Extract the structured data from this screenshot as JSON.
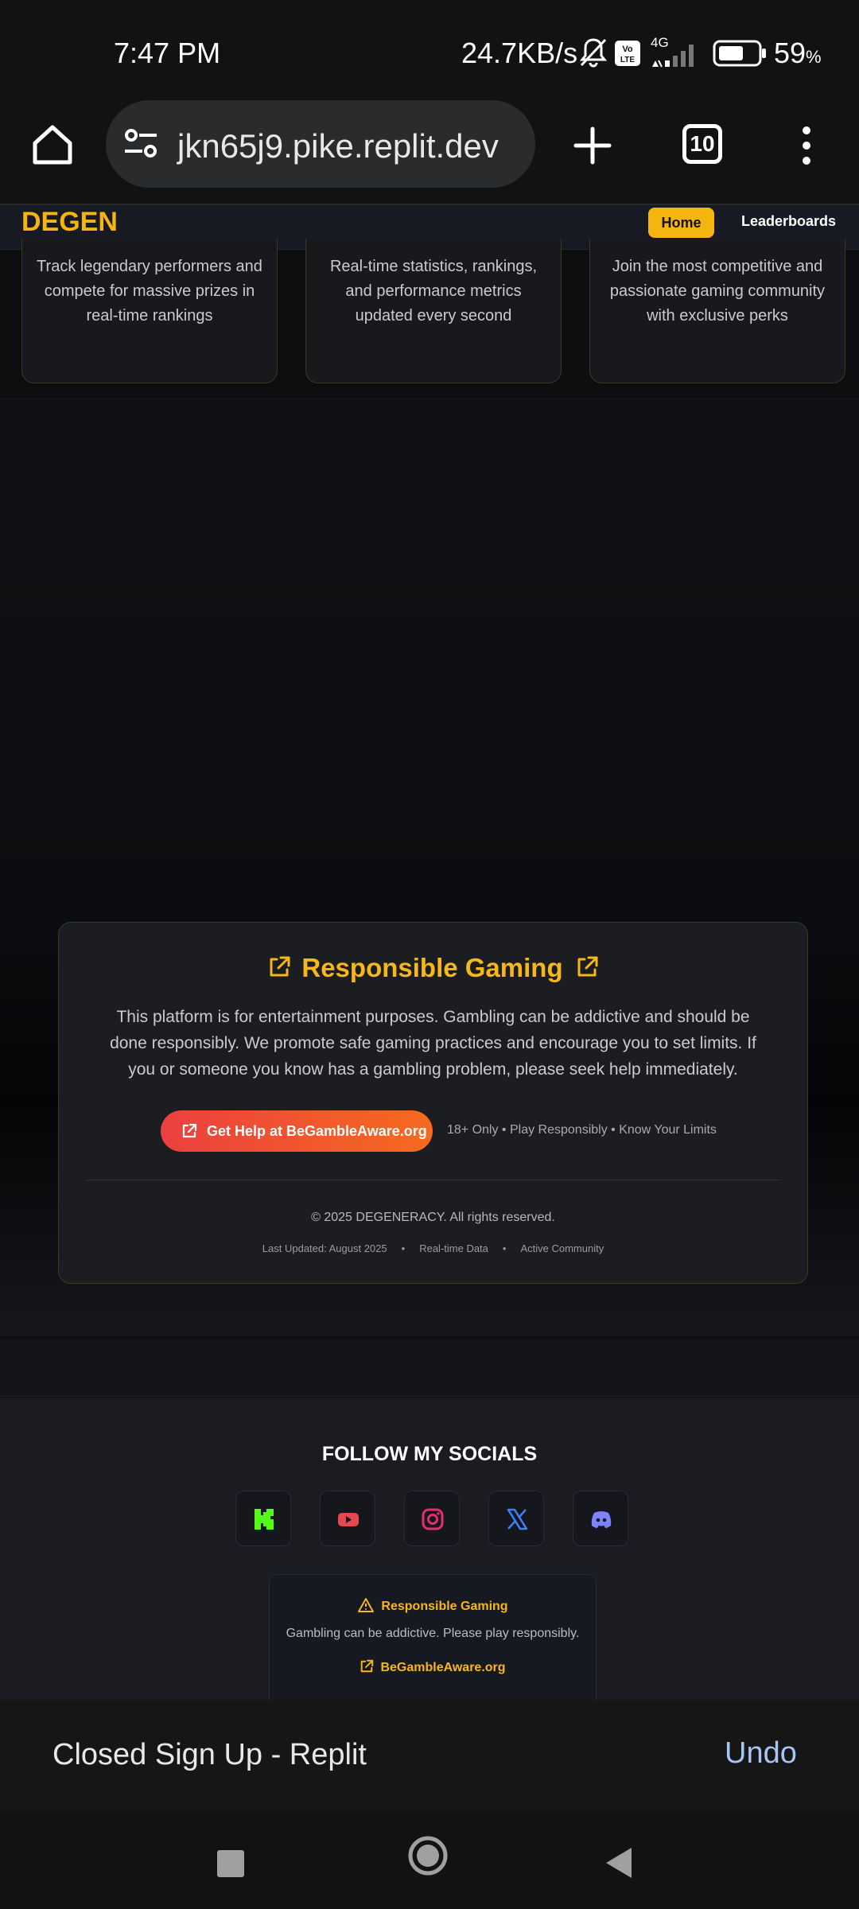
{
  "status_bar": {
    "time": "7:47 PM",
    "network_speed": "24.7KB/s",
    "network_type": "4G",
    "battery": "59",
    "battery_unit": "%"
  },
  "browser": {
    "url": "jkn65j9.pike.replit.dev",
    "tabs_count": "10"
  },
  "site_nav": {
    "brand": "DEGEN",
    "items": [
      {
        "label": "Home"
      },
      {
        "label": "Leaderboards"
      }
    ]
  },
  "features": [
    {
      "text": "Track legendary performers and compete for massive prizes in real-time rankings"
    },
    {
      "text": "Real-time statistics, rankings, and performance metrics updated every second"
    },
    {
      "text": "Join the most competitive and passionate gaming community with exclusive perks"
    }
  ],
  "responsible_gaming": {
    "title": "Responsible Gaming",
    "text": "This platform is for entertainment purposes. Gambling can be addictive and should be done responsibly. We promote safe gaming practices and encourage you to set limits. If you or someone you know has a gambling problem, please seek help immediately.",
    "help_button": "Get Help at BeGambleAware.org",
    "aux": "18+ Only • Play Responsibly • Know Your Limits",
    "copyright": "© 2025 DEGENERACY. All rights reserved.",
    "meta": [
      "Last Updated: August 2025",
      "Real-time Data",
      "Active Community"
    ],
    "meta_separator": "•"
  },
  "footer": {
    "follow_title": "FOLLOW MY SOCIALS",
    "socials": [
      {
        "icon": "kick-icon",
        "color": "#53fc18"
      },
      {
        "icon": "youtube-icon",
        "color": "#e5484d"
      },
      {
        "icon": "instagram-icon",
        "color": "#e1306c"
      },
      {
        "icon": "x-icon",
        "color": "#3b82f6"
      },
      {
        "icon": "discord-icon",
        "color": "#7c83fd"
      }
    ],
    "mini_rg": {
      "title": "Responsible Gaming",
      "text": "Gambling can be addictive. Please play responsibly.",
      "link": "BeGambleAware.org"
    }
  },
  "snackbar": {
    "text": "Closed Sign Up - Replit",
    "action": "Undo"
  },
  "colors": {
    "accent": "#f6b40e",
    "help_gradient_start": "#ec4040",
    "help_gradient_end": "#f56a1e",
    "undo": "#a8c4f5"
  }
}
